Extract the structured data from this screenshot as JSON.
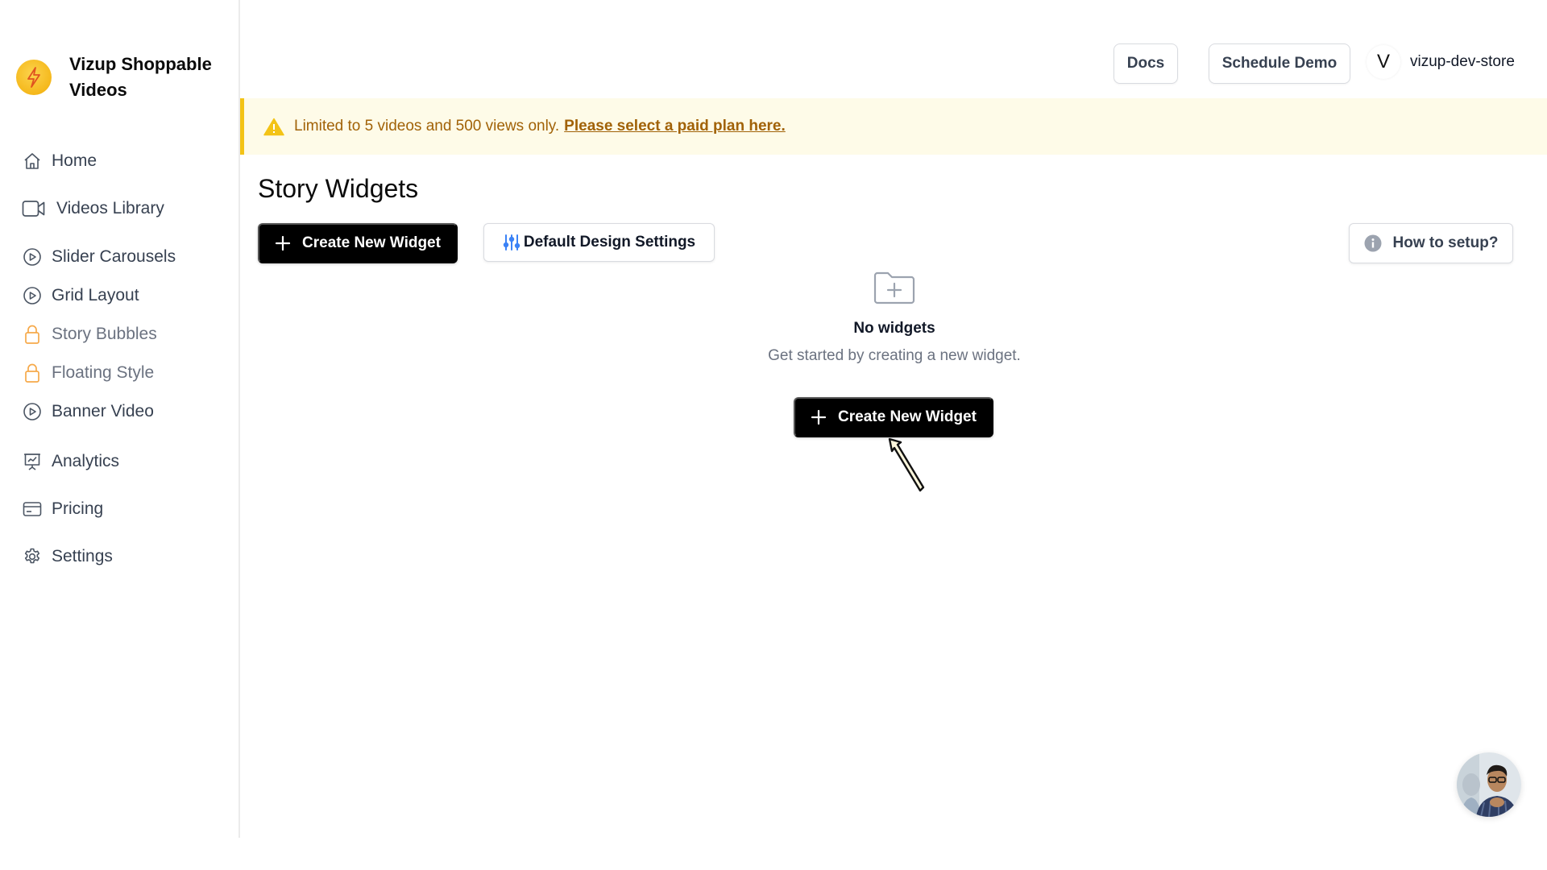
{
  "app": {
    "name": "Vizup Shoppable Videos",
    "brand_color": "#f5b81b"
  },
  "sidebar": {
    "items": [
      {
        "label": "Home",
        "icon": "home-icon",
        "locked": false
      },
      {
        "label": "Videos Library",
        "icon": "video-camera-icon",
        "locked": false
      },
      {
        "label": "Slider Carousels",
        "icon": "play-circle-icon",
        "locked": false
      },
      {
        "label": "Grid Layout",
        "icon": "play-circle-icon",
        "locked": false
      },
      {
        "label": "Story Bubbles",
        "icon": "lock-icon",
        "locked": true
      },
      {
        "label": "Floating Style",
        "icon": "lock-icon",
        "locked": true
      },
      {
        "label": "Banner Video",
        "icon": "play-circle-icon",
        "locked": false
      },
      {
        "label": "Analytics",
        "icon": "presentation-chart-icon",
        "locked": false
      },
      {
        "label": "Pricing",
        "icon": "credit-card-icon",
        "locked": false
      },
      {
        "label": "Settings",
        "icon": "gear-icon",
        "locked": false
      }
    ],
    "lock_color": "#f6a94a"
  },
  "header": {
    "docs_label": "Docs",
    "schedule_demo_label": "Schedule Demo",
    "store_initial": "V",
    "store_name": "vizup-dev-store"
  },
  "banner": {
    "icon": "warning-icon",
    "text": "Limited to 5 videos and 500 views only.",
    "link_text": "Please select a paid plan here.",
    "accent_color": "#f3c316",
    "text_color": "#a16207"
  },
  "main": {
    "title": "Story Widgets",
    "create_button_label": "Create New Widget",
    "design_settings_label": "Default Design Settings",
    "how_to_setup_label": "How to setup?",
    "empty_state": {
      "title": "No widgets",
      "subtitle": "Get started by creating a new widget.",
      "button_label": "Create New Widget"
    }
  }
}
